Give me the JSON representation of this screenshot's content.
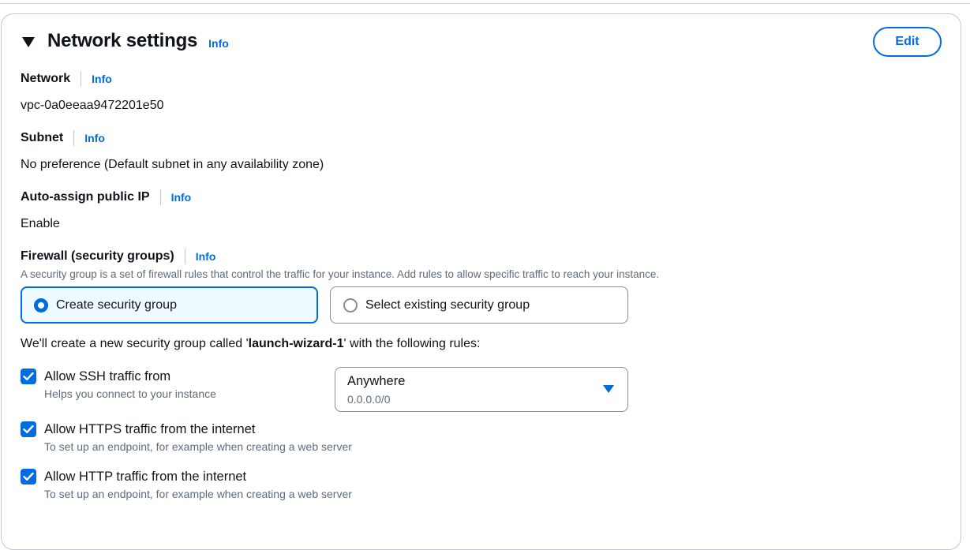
{
  "section": {
    "title": "Network settings",
    "info_label": "Info",
    "edit_label": "Edit"
  },
  "network": {
    "label": "Network",
    "info": "Info",
    "value": "vpc-0a0eeaa9472201e50"
  },
  "subnet": {
    "label": "Subnet",
    "info": "Info",
    "value": "No preference (Default subnet in any availability zone)"
  },
  "public_ip": {
    "label": "Auto-assign public IP",
    "info": "Info",
    "value": "Enable"
  },
  "firewall": {
    "label": "Firewall (security groups)",
    "info": "Info",
    "description": "A security group is a set of firewall rules that control the traffic for your instance. Add rules to allow specific traffic to reach your instance.",
    "options": [
      {
        "label": "Create security group",
        "selected": true
      },
      {
        "label": "Select existing security group",
        "selected": false
      }
    ],
    "sentence_prefix": "We'll create a new security group called '",
    "group_name": "launch-wizard-1",
    "sentence_suffix": "' with the following rules:"
  },
  "rules": [
    {
      "label": "Allow SSH traffic from",
      "description": "Helps you connect to your instance",
      "checked": true
    },
    {
      "label": "Allow HTTPS traffic from the internet",
      "description": "To set up an endpoint, for example when creating a web server",
      "checked": true
    },
    {
      "label": "Allow HTTP traffic from the internet",
      "description": "To set up an endpoint, for example when creating a web server",
      "checked": true
    }
  ],
  "ssh_source": {
    "value": "Anywhere",
    "sub": "0.0.0.0/0"
  },
  "colors": {
    "accent": "#006ce0",
    "selected_bg": "#f0fbff",
    "muted_text": "#5f6b7a",
    "border": "#8c8c94"
  }
}
